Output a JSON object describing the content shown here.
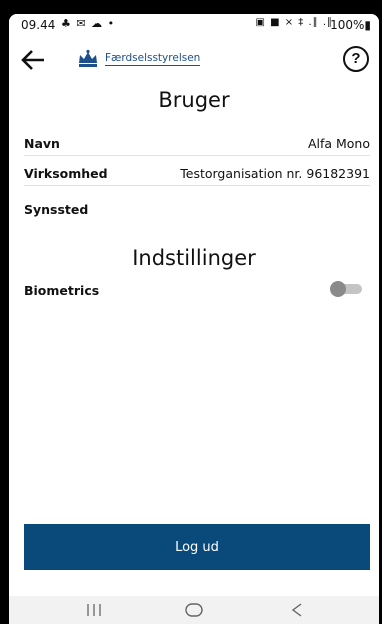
{
  "status_bar": {
    "time": "09.44",
    "left_icons": "♣ ✉ ☁ •",
    "right_icons": "▣ ■ × ‡ .∥ .∥",
    "battery": "100%▮"
  },
  "header": {
    "logo_text": "Færdselsstyrelsen",
    "help_label": "?",
    "icons": {
      "back": "arrow-left-icon",
      "logo": "crown-logo-icon",
      "help": "question-circle-icon"
    }
  },
  "user_section": {
    "title": "Bruger",
    "rows": [
      {
        "label": "Navn",
        "value": "Alfa Mono"
      },
      {
        "label": "Virksomhed",
        "value": "Testorganisation nr. 96182391"
      },
      {
        "label": "Synssted",
        "value": ""
      }
    ]
  },
  "settings_section": {
    "title": "Indstillinger",
    "biometrics_label": "Biometrics",
    "biometrics_enabled": false
  },
  "logout_label": "Log ud",
  "nav_bar": {
    "recents_icon": "recents-icon",
    "home_icon": "home-icon",
    "back_icon": "back-chevron-icon"
  },
  "colors": {
    "primary": "#0a4a7a",
    "logo_blue": "#1d4f8a",
    "toggle_off_track": "#c4c4c4",
    "toggle_off_knob": "#8a8a8a"
  }
}
